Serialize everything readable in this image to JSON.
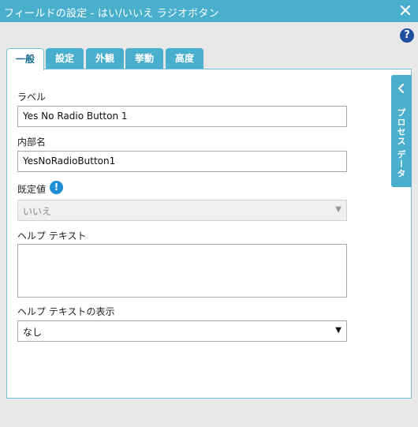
{
  "window": {
    "title": "フィールドの設定 - はい/いいえ ラジオボタン",
    "close_icon": "close-icon",
    "help_icon": "question-icon",
    "help_glyph": "?"
  },
  "tabs": [
    {
      "label": "一般",
      "active": true
    },
    {
      "label": "設定",
      "active": false
    },
    {
      "label": "外観",
      "active": false
    },
    {
      "label": "挙動",
      "active": false
    },
    {
      "label": "高度",
      "active": false
    }
  ],
  "form": {
    "label_field": {
      "label": "ラベル",
      "value": "Yes No Radio Button 1"
    },
    "internal_name": {
      "label": "内部名",
      "value": "YesNoRadioButton1"
    },
    "default_value": {
      "label": "既定値",
      "value": "いいえ",
      "info_icon": "info-icon",
      "info_glyph": "!",
      "disabled": true
    },
    "help_text": {
      "label": "ヘルプ テキスト",
      "value": ""
    },
    "help_text_display": {
      "label": "ヘルプ テキストの表示",
      "value": "なし"
    }
  },
  "side_panel": {
    "label": "プロセス データ",
    "icon": "chevron-left-icon"
  },
  "colors": {
    "accent": "#4aaecd",
    "help_icon": "#1f4fa1",
    "info_icon": "#1d8fd6"
  }
}
